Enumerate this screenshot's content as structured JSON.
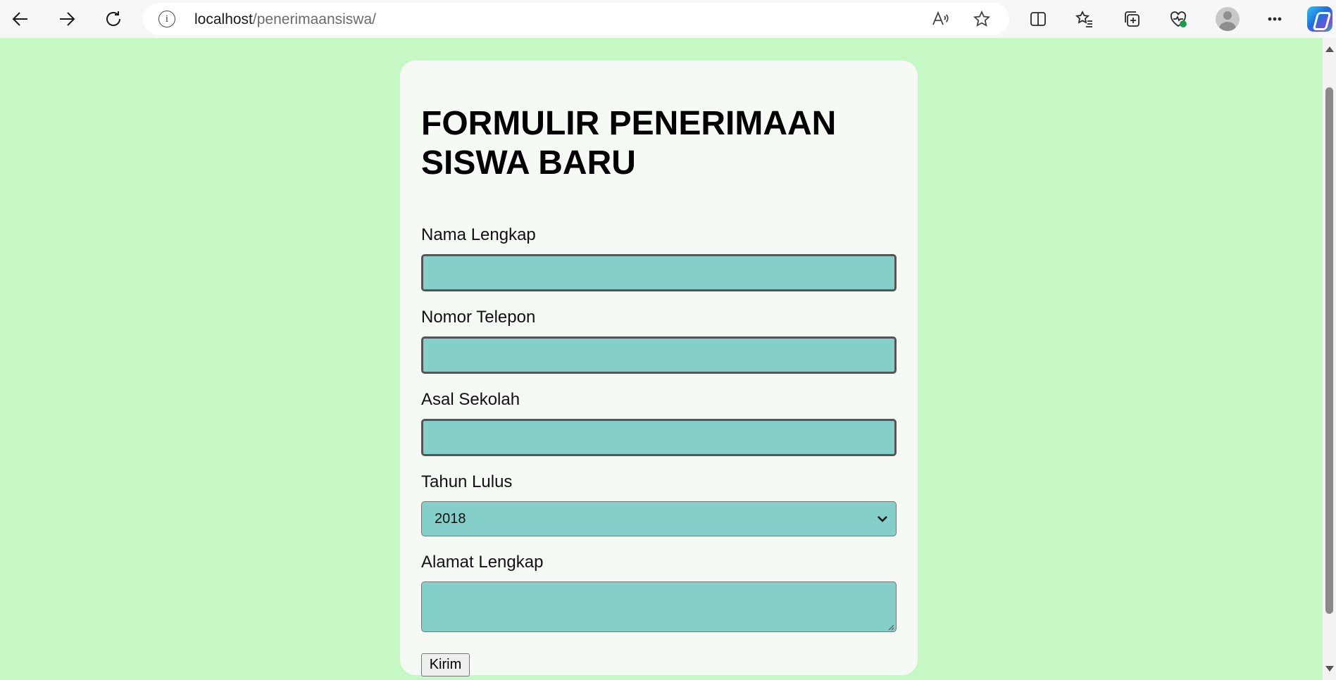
{
  "browser": {
    "url_host": "localhost",
    "url_path": "/penerimaansiswa/",
    "info_glyph": "i",
    "icons": [
      "back-icon",
      "forward-icon",
      "refresh-icon",
      "info-icon",
      "read-aloud-icon",
      "favorite-star-icon",
      "split-screen-icon",
      "favorites-list-icon",
      "collections-icon",
      "browser-health-icon",
      "profile-avatar",
      "more-options-icon",
      "copilot-icon"
    ]
  },
  "page": {
    "background": "#c5f8c4",
    "card_background": "#f5faf5",
    "input_background": "#84cfca"
  },
  "form": {
    "title": "FORMULIR PENERIMAAN SISWA BARU",
    "fields": {
      "nama_label": "Nama Lengkap",
      "nama_value": "",
      "telepon_label": "Nomor Telepon",
      "telepon_value": "",
      "sekolah_label": "Asal Sekolah",
      "sekolah_value": "",
      "tahun_label": "Tahun Lulus",
      "tahun_value": "2018",
      "alamat_label": "Alamat Lengkap",
      "alamat_value": ""
    },
    "submit_label": "Kirim"
  }
}
